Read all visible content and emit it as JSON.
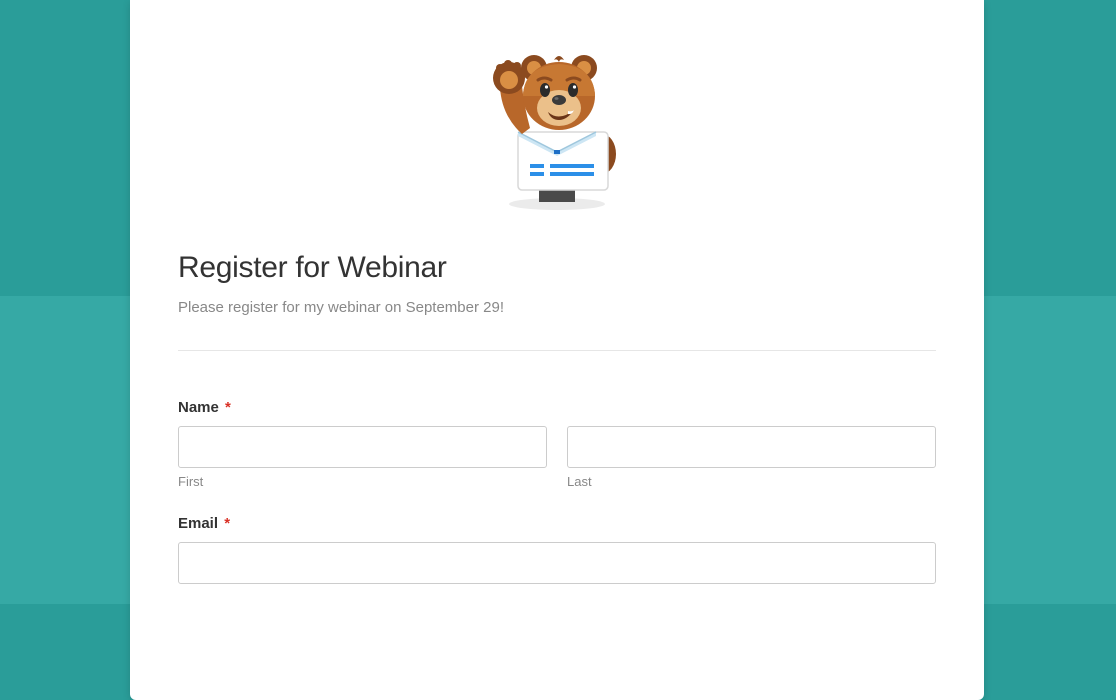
{
  "form": {
    "title": "Register for Webinar",
    "description": "Please register for my webinar on September 29!",
    "fields": {
      "name": {
        "label": "Name",
        "required_mark": "*",
        "first_sublabel": "First",
        "last_sublabel": "Last",
        "first_value": "",
        "last_value": ""
      },
      "email": {
        "label": "Email",
        "required_mark": "*",
        "value": ""
      }
    }
  },
  "mascot": {
    "name": "bear-mascot",
    "colors": {
      "fur_dark": "#8B4A1F",
      "fur_mid": "#B8672A",
      "fur_light": "#D98F44",
      "snout": "#EBC08A",
      "shirt": "#FFFFFF",
      "collar": "#CDE6F4",
      "blue": "#1E6FC6",
      "line_blue": "#2B8FE8"
    }
  }
}
